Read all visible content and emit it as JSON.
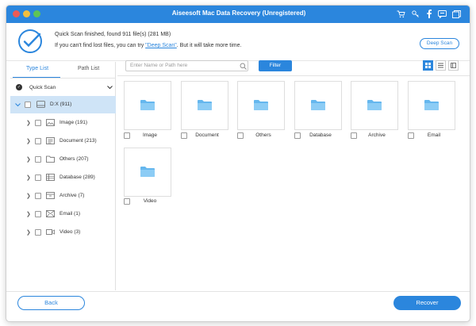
{
  "window": {
    "title": "Aiseesoft Mac Data Recovery (Unregistered)",
    "accent": "#2b86dd",
    "titlebar_icons": [
      "cart-icon",
      "key-icon",
      "facebook-icon",
      "chat-icon",
      "restore-icon"
    ]
  },
  "status": {
    "line1": "Quick Scan finished, found 911 file(s) (281 MB)",
    "line2_prefix": "If you can't find lost files, you can try ",
    "line2_link": "\"Deep Scan\"",
    "line2_suffix": ". But it will take more time.",
    "deep_scan_button": "Deep Scan"
  },
  "sidebar": {
    "tabs": [
      {
        "label": "Type List",
        "active": true
      },
      {
        "label": "Path List",
        "active": false
      }
    ],
    "quick_scan_label": "Quick Scan",
    "drive": {
      "label": "D:X (911)",
      "icon": "drive-icon"
    },
    "items": [
      {
        "label": "Image (191)",
        "icon": "image-icon"
      },
      {
        "label": "Document (213)",
        "icon": "document-icon"
      },
      {
        "label": "Others (207)",
        "icon": "folder-icon"
      },
      {
        "label": "Database (289)",
        "icon": "database-icon"
      },
      {
        "label": "Archive (7)",
        "icon": "archive-icon"
      },
      {
        "label": "Email (1)",
        "icon": "email-icon"
      },
      {
        "label": "Video (3)",
        "icon": "video-icon"
      }
    ]
  },
  "toolbar": {
    "search_placeholder": "Enter Name or Path here",
    "filter_label": "Filter",
    "views": [
      "grid-view-icon",
      "list-view-icon",
      "detail-view-icon"
    ]
  },
  "tiles": [
    {
      "label": "Image"
    },
    {
      "label": "Document"
    },
    {
      "label": "Others"
    },
    {
      "label": "Database"
    },
    {
      "label": "Archive"
    },
    {
      "label": "Email"
    },
    {
      "label": "Video"
    }
  ],
  "footer": {
    "back_label": "Back",
    "recover_label": "Recover"
  }
}
